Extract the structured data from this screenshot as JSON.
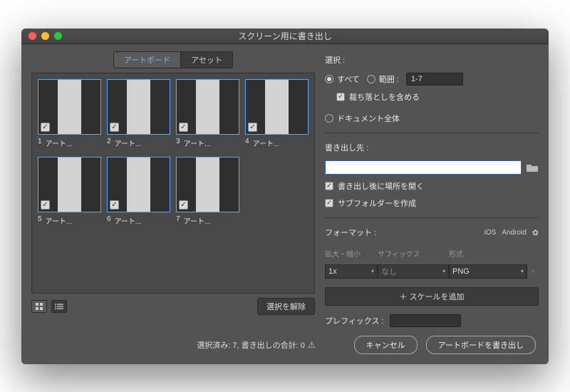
{
  "title": "スクリーン用に書き出し",
  "tabs": {
    "artboards": "アートボード",
    "assets": "アセット"
  },
  "thumbs": [
    {
      "num": "1",
      "name": "アート..."
    },
    {
      "num": "2",
      "name": "アート..."
    },
    {
      "num": "3",
      "name": "アート..."
    },
    {
      "num": "4",
      "name": "アート..."
    },
    {
      "num": "5",
      "name": "アート..."
    },
    {
      "num": "6",
      "name": "アート..."
    },
    {
      "num": "7",
      "name": "アート..."
    }
  ],
  "clear_selection": "選択を解除",
  "selection": {
    "label": "選択 :",
    "all": "すべて",
    "range_label": "範囲 :",
    "range_value": "1-7",
    "include_bleed": "裁ち落としを含める",
    "full_document": "ドキュメント全体"
  },
  "export_to": {
    "label": "書き出し先 :",
    "path": "",
    "open_after": "書き出し後に場所を開く",
    "create_subfolders": "サブフォルダーを作成"
  },
  "format": {
    "label": "フォーマット :",
    "ios": "iOS",
    "android": "Android",
    "col_scale": "拡大・縮小",
    "col_suffix": "サフィックス",
    "col_type": "形式",
    "scale": "1x",
    "suffix": "なし",
    "type": "PNG",
    "add_scale": "＋ スケールを追加"
  },
  "prefix": {
    "label": "プレフィックス :",
    "value": ""
  },
  "status": "選択済み: 7, 書き出しの合計: 0",
  "buttons": {
    "cancel": "キャンセル",
    "export": "アートボードを書き出し"
  }
}
